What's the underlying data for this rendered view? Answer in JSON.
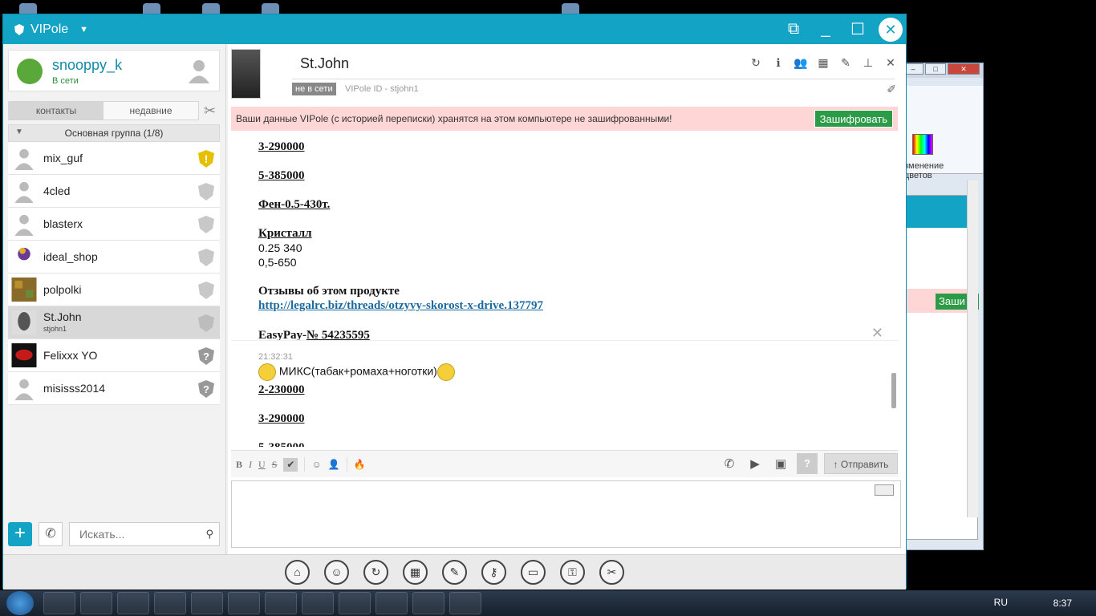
{
  "window": {
    "app_name": "VIPole",
    "dropdown_glyph": "▼",
    "controls": [
      "restore",
      "minimize",
      "maximize",
      "close"
    ]
  },
  "profile": {
    "username": "snooppy_k",
    "status": "В сети"
  },
  "tabs": [
    "контакты",
    "недавние"
  ],
  "group": {
    "label": "Основная группа (1/8)"
  },
  "contacts": [
    {
      "name": "mix_guf",
      "badge": "warning-shield-icon"
    },
    {
      "name": "4cled",
      "badge": "shield-icon"
    },
    {
      "name": "blasterx",
      "badge": "shield-icon"
    },
    {
      "name": "ideal_shop",
      "badge": "shield-icon"
    },
    {
      "name": "polpolki",
      "badge": "shield-icon"
    },
    {
      "name": "St.John",
      "subtitle": "stjohn1",
      "badge": "shield-icon",
      "selected": true
    },
    {
      "name": "Felixxx YO",
      "badge": "unknown-shield-icon"
    },
    {
      "name": "misisss2014",
      "badge": "unknown-shield-icon"
    }
  ],
  "search": {
    "placeholder": "Искать..."
  },
  "chat": {
    "peer_name": "St.John",
    "peer_status": "не в сети",
    "peer_id": "VIPole ID - stjohn1",
    "warning_text": "Ваши данные VIPole (с историей переписки) хранятся на этом компьютере не зашифрованными!",
    "encrypt_label": "Зашифровать",
    "messages": {
      "l1": "3-290000",
      "l2": "5-385000",
      "l3": "Фен-0.5-430т.",
      "l4": "Кристалл",
      "l5": "0.25 340",
      "l6": "0,5-650",
      "l7": "Отзывы об этом продукте",
      "l8": "http://legalrc.biz/threads/otzyvy-skorost-x-drive.137797",
      "l9a": "EasyPay-",
      "l9b": "№ 54235595",
      "timestamp": "21:32:31",
      "l10": "МИКС(табак+ромаха+ноготки)",
      "l11": "2-230000",
      "l12": "3-290000",
      "l13": "5-385000"
    },
    "format_buttons": [
      "B",
      "I",
      "U",
      "S"
    ],
    "send_label": "Отправить"
  },
  "taskbar": {
    "lang": "RU",
    "time": "8:37"
  },
  "colors": {
    "accent": "#13a3c4",
    "warning_bg": "#ffd6d6",
    "encrypt_btn": "#2c9b47",
    "online": "#2c8f3c"
  }
}
